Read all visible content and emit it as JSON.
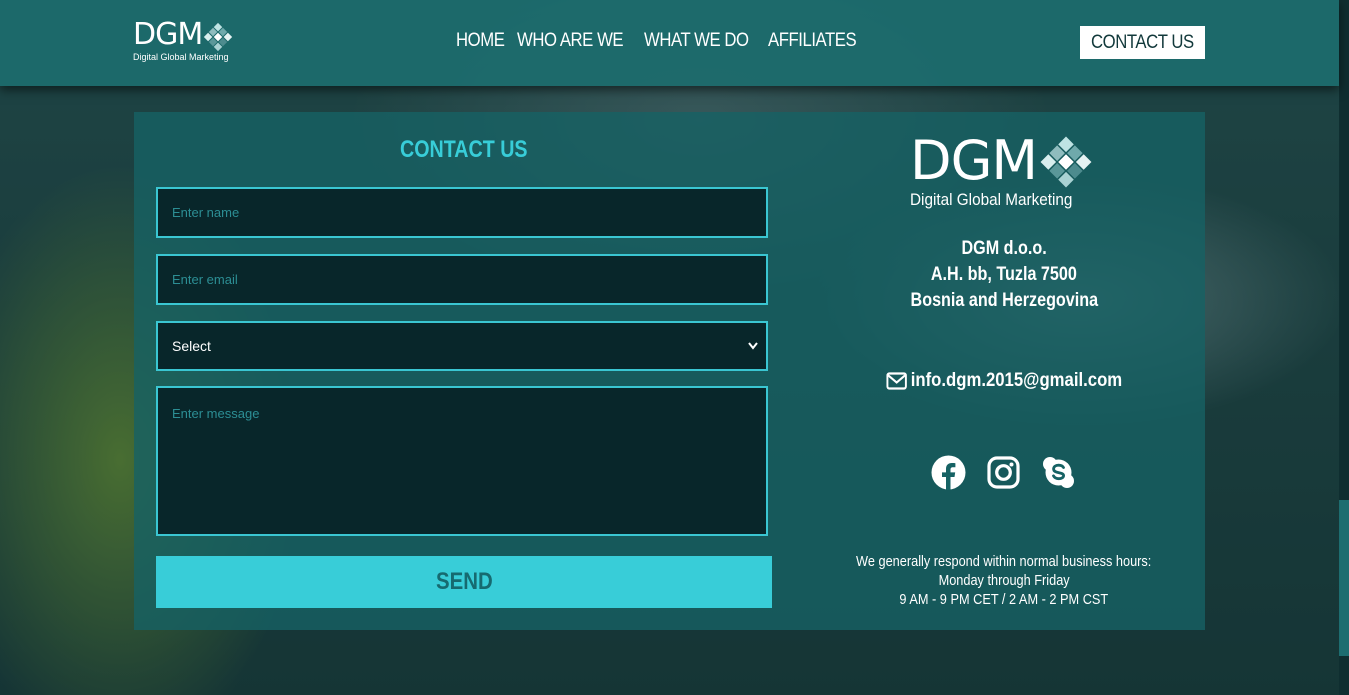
{
  "header": {
    "logo_word": "DGM",
    "logo_sub": "Digital Global Marketing",
    "nav": [
      "HOME",
      "WHO ARE WE",
      "WHAT WE DO",
      "AFFILIATES"
    ],
    "contact_button": "CONTACT US"
  },
  "form": {
    "title": "CONTACT US",
    "name_placeholder": "Enter name",
    "email_placeholder": "Enter email",
    "select_value": "Select",
    "message_placeholder": "Enter message",
    "send_label": "SEND"
  },
  "info": {
    "logo_word": "DGM",
    "logo_sub": "Digital Global Marketing",
    "address": [
      "DGM d.o.o.",
      "A.H. bb, Tuzla 7500",
      "Bosnia and Herzegovina"
    ],
    "email": "info.dgm.2015@gmail.com",
    "socials": [
      "facebook-icon",
      "instagram-icon",
      "skype-icon"
    ],
    "hours": [
      "We generally respond within normal business hours:",
      "Monday through Friday",
      "9 AM - 9 PM CET / 2 AM - 2 PM CST"
    ]
  },
  "colors": {
    "accent": "#38cdd8",
    "panel": "#166264",
    "field_bg": "#08262a"
  }
}
